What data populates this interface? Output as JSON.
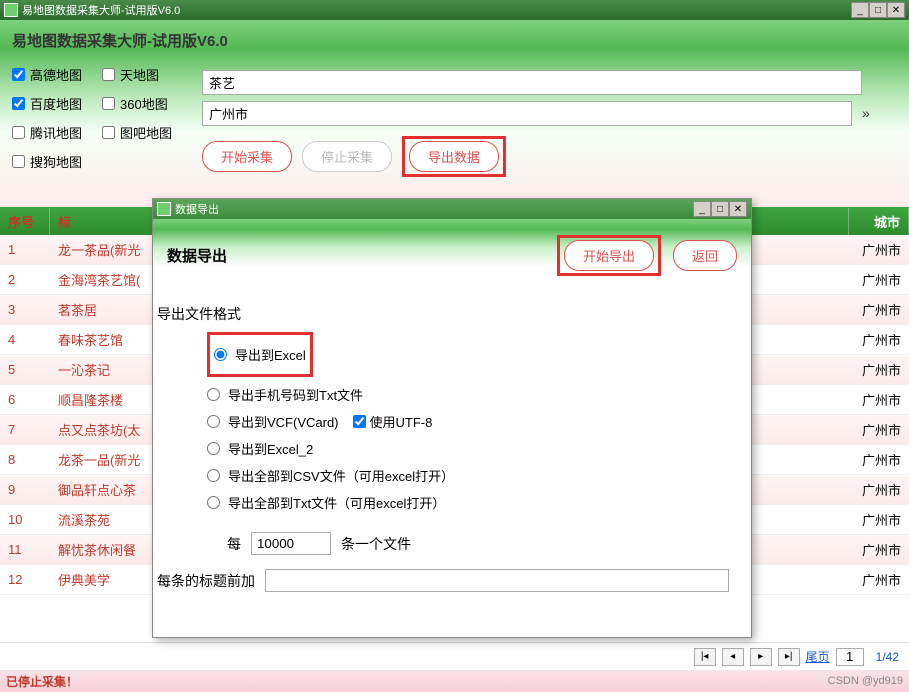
{
  "window": {
    "title": "易地图数据采集大师-试用版V6.0"
  },
  "header": {
    "title": "易地图数据采集大师-试用版V6.0",
    "maps": {
      "gaode": {
        "label": "高德地图",
        "checked": true
      },
      "baidu": {
        "label": "百度地图",
        "checked": true
      },
      "tencent": {
        "label": "腾讯地图",
        "checked": false
      },
      "sogou": {
        "label": "搜狗地图",
        "checked": false
      },
      "tianditu": {
        "label": "天地图",
        "checked": false
      },
      "map360": {
        "label": "360地图",
        "checked": false
      },
      "tuba": {
        "label": "图吧地图",
        "checked": false
      }
    },
    "keyword": "茶艺",
    "city": "广州市",
    "arrow": "»",
    "buttons": {
      "start": "开始采集",
      "stop": "停止采集",
      "export": "导出数据"
    }
  },
  "table": {
    "cols": {
      "idx": "序号",
      "title": "标",
      "city": "城市"
    },
    "rows": [
      {
        "idx": "1",
        "title": "龙一茶品(新光",
        "city": "广州市"
      },
      {
        "idx": "2",
        "title": "金海湾茶艺馆(",
        "city": "广州市"
      },
      {
        "idx": "3",
        "title": "茗茶居",
        "city": "广州市"
      },
      {
        "idx": "4",
        "title": "春味茶艺馆",
        "city": "广州市"
      },
      {
        "idx": "5",
        "title": "一沁茶记",
        "city": "广州市"
      },
      {
        "idx": "6",
        "title": "顺昌隆茶楼",
        "city": "广州市"
      },
      {
        "idx": "7",
        "title": "点又点茶坊(太",
        "city": "广州市"
      },
      {
        "idx": "8",
        "title": "龙茶一品(新光",
        "city": "广州市"
      },
      {
        "idx": "9",
        "title": "御品轩点心茶",
        "city": "广州市"
      },
      {
        "idx": "10",
        "title": "流溪茶苑",
        "city": "广州市"
      },
      {
        "idx": "11",
        "title": "解忧茶休闲餐",
        "city": "广州市"
      },
      {
        "idx": "12",
        "title": "伊典美学",
        "city": "广州市"
      }
    ]
  },
  "modal": {
    "wintitle": "数据导出",
    "title": "数据导出",
    "buttons": {
      "start": "开始导出",
      "back": "返回"
    },
    "format_label": "导出文件格式",
    "options": {
      "excel": "导出到Excel",
      "txt": "导出手机号码到Txt文件",
      "vcf": "导出到VCF(VCard)",
      "utf8": "使用UTF-8",
      "excel2": "导出到Excel_2",
      "csv": "导出全部到CSV文件（可用excel打开）",
      "txtall": "导出全部到Txt文件（可用excel打开）"
    },
    "split": {
      "prefix": "每",
      "value": "10000",
      "suffix": "条一个文件"
    },
    "prefix_label": "每条的标题前加",
    "prefix_value": ""
  },
  "pager": {
    "home": "尾页",
    "page": "1",
    "total": "1/42"
  },
  "status": {
    "text": "已停止采集！",
    "watermark": "CSDN @yd919"
  }
}
